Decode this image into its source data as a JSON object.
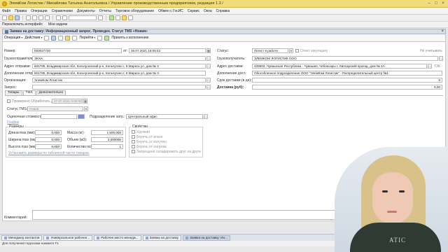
{
  "window": {
    "title": "ЭлемКом Логистик / Михайлова Татьяна Анатольевна / Управление производственным предприятием, редакция 1.3 /"
  },
  "menu": [
    "Файл",
    "Правка",
    "Операции",
    "Справочники",
    "Документы",
    "Отчеты",
    "Торговое оборудование",
    "Обмен с ГосИС",
    "Сервис",
    "Окна",
    "Справка"
  ],
  "iface": {
    "switch": "Переключить интерфейс",
    "tasks": "Мои задачи"
  },
  "form": {
    "header": "Заявка на доставку: Информационный запрос. Проведен. Статус ТМS «Новая»",
    "tools": {
      "operation": "Операция",
      "actions": "Действия",
      "goto": "Перейти",
      "accept": "Принять к исполнению"
    },
    "fields": {
      "number_label": "Номер:",
      "number": "000027720",
      "date_label": "от:",
      "date": "26.07.2021 16:08:42",
      "status_label": "Статус:",
      "status": "Логист в работе",
      "sub_label": "Ответ закупщику",
      "not_exec": "Не учитывать",
      "sender_label": "Грузоотправитель:",
      "sender": "ЭКХА",
      "receiver_label": "Грузополучатель:",
      "receiver": "ЭЛЕМКОМ ЛОГИСТИК ООО",
      "addr_from_label": "Адрес отправки:",
      "addr_from": "601785, Владимирская обл, Кольчугинский р-н, Кольчугино г, К.Маркса ул, дом № 3",
      "addr_to_label": "Адрес доставки:",
      "addr_to": "428903, Чувашская Республика - Чувашия, Чебоксары г, Лапсарский проезд, дом № 2А",
      "tzk": "ТЗК",
      "addr_from2_label": "Дополнение отпр.:",
      "addr_from2": "601785, Владимирская обл, Кольчугинский р-н, Кольчугино г, К.Маркса ул, дом № 3",
      "addr_to2_label": "Дополнение дост.:",
      "addr_to2": "Обособленное подразделение ООО \"ЭлемКом Логистик\" - Распределительный центр №1",
      "org_label": "Организация:",
      "org": "ЭлемКом Логистик",
      "term_label": "Срок доставки (в дн):",
      "term": "0",
      "request_label": "Запрос:",
      "cost_label": "Доставка (руб):",
      "cost": "0,00"
    },
    "tabs": [
      "Товары",
      "ТМS",
      "Дополнительно"
    ],
    "tms": {
      "checked_label": "Проверено Обработать д.",
      "checked_value": "27.07.2021 0:00:00",
      "status_label": "Статус ТМS:",
      "status_value": "Новая",
      "est_label": "Оценочная стоимость:",
      "dept_label": "Подразделение затр.:",
      "dept_value": "Центральный офис",
      "graph_label": "График",
      "dims_title": "Размеры",
      "len_label": "Длина max (мм):",
      "len": "0,000",
      "width_label": "Ширина max (мм):",
      "width": "0,000",
      "height_label": "Высота max (мм):",
      "height": "0,000",
      "mass_label": "Масса (кг):",
      "mass": "1 500,000",
      "vol_label": "Объем (м3):",
      "vol": "3,000000",
      "qty_label": "Количество пос.:",
      "qty": "1",
      "calc_link": "Установить размеры по табличной части товаров",
      "props_title": "Свойства",
      "props": [
        "Хрупкий",
        "Беречь от влаги",
        "Беречь от излучен.",
        "Беречь от нагрева",
        "Запрещено складировать друг на друге"
      ]
    },
    "comment_label": "Комментарий:"
  },
  "taskbar": [
    "Менеджер контактов",
    "Универсальное рабочее...",
    "Рабочее место менедж...",
    "Заявка на доставку",
    "Заявка на доставку: Ин..."
  ],
  "status_hint": "Для получения подсказки нажмите F1",
  "webcam": {
    "shirt_text": "ATIC"
  }
}
